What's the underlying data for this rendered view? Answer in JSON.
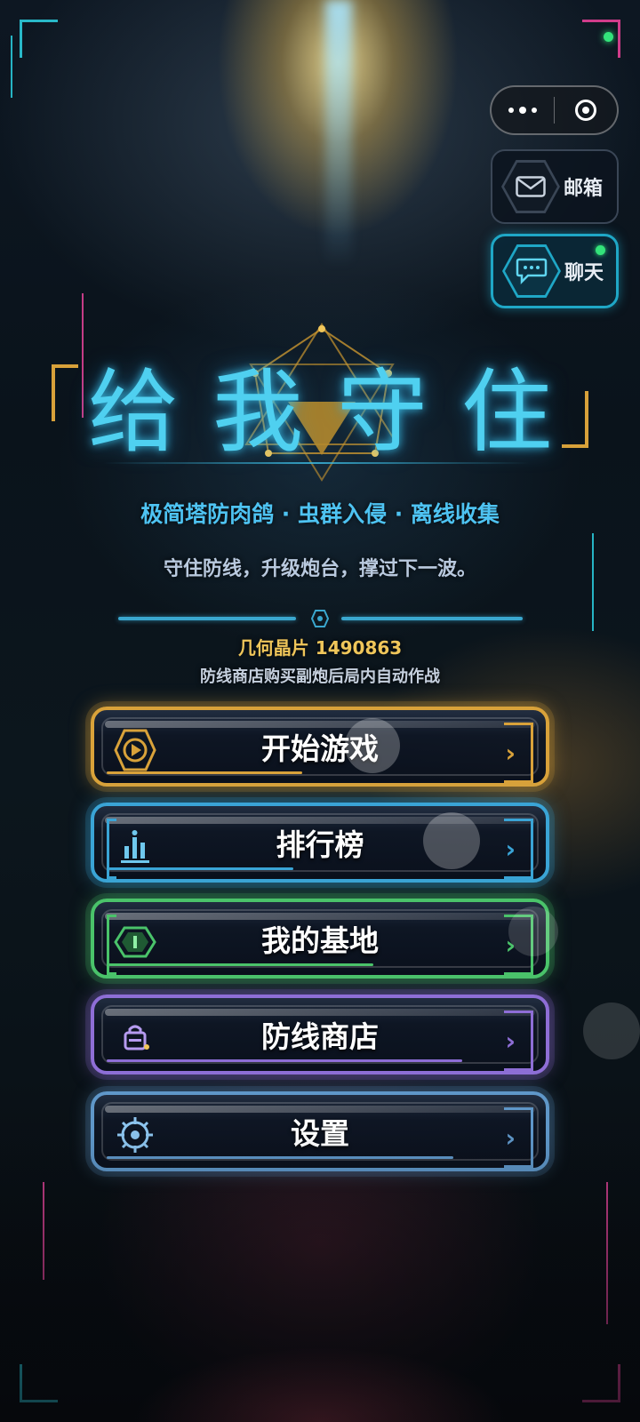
{
  "capsule": {
    "more_icon": "more-dots-icon",
    "close_icon": "target-circle-icon"
  },
  "side_buttons": {
    "mail": {
      "label": "邮箱",
      "icon": "mail-icon"
    },
    "chat": {
      "label": "聊天",
      "icon": "chat-bubble-icon",
      "has_new": true
    }
  },
  "title": {
    "text": "给我守住",
    "subtitle": "极简塔防肉鸽 · 虫群入侵 · 离线收集",
    "tagline": "守住防线，升级炮台，撑过下一波。"
  },
  "currency": {
    "text": "几何晶片 1490863"
  },
  "hint": "防线商店购买副炮后局内自动作战",
  "menu": [
    {
      "label": "开始游戏",
      "icon": "play-icon",
      "color": "#d9a23a"
    },
    {
      "label": "排行榜",
      "icon": "leaderboard-icon",
      "color": "#3aa4d6"
    },
    {
      "label": "我的基地",
      "icon": "base-gem-icon",
      "color": "#4ac36a"
    },
    {
      "label": "防线商店",
      "icon": "shop-bag-icon",
      "color": "#8e6ed6"
    },
    {
      "label": "设置",
      "icon": "settings-gear-icon",
      "color": "#5f97c9"
    }
  ],
  "chevron": "›",
  "colors": {
    "title": "#4fd0f0",
    "subtitle": "#4ec3f2",
    "currency": "#f0c65a",
    "accent_gold": "#d8a13a"
  }
}
